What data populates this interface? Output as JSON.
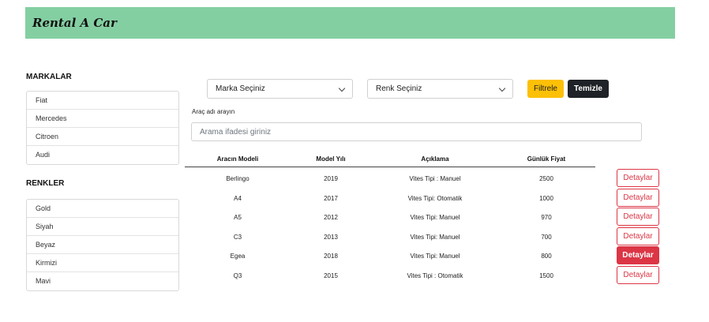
{
  "header": {
    "brand": "Rental A Car"
  },
  "sidebar": {
    "brands_title": "MARKALAR",
    "brands": [
      "Fiat",
      "Mercedes",
      "Citroen",
      "Audi"
    ],
    "colors_title": "RENKLER",
    "colors": [
      "Gold",
      "Siyah",
      "Beyaz",
      "Kirmizi",
      "Mavi"
    ]
  },
  "filters": {
    "brand_select": "Marka Seçiniz",
    "color_select": "Renk Seçiniz",
    "filter_button": "Filtrele",
    "clear_button": "Temizle"
  },
  "search": {
    "label": "Araç adı arayın",
    "placeholder": "Arama ifadesi giriniz",
    "value": ""
  },
  "table": {
    "headers": [
      "Aracın Modeli",
      "Model Yılı",
      "Açıklama",
      "Günlük Fiyat"
    ],
    "rows": [
      {
        "model": "Berlingo",
        "year": "2019",
        "description": "Vites Tipi : Manuel",
        "price": "2500",
        "button": "Detaylar"
      },
      {
        "model": "A4",
        "year": "2017",
        "description": "Vites Tipi: Otomatik",
        "price": "1000",
        "button": "Detaylar"
      },
      {
        "model": "A5",
        "year": "2012",
        "description": "Vites Tipi: Manuel",
        "price": "970",
        "button": "Detaylar"
      },
      {
        "model": "C3",
        "year": "2013",
        "description": "Vites Tipi: Manuel",
        "price": "700",
        "button": "Detaylar"
      },
      {
        "model": "Egea",
        "year": "2018",
        "description": "Vites Tipi: Manuel",
        "price": "800",
        "button": "Detaylar"
      },
      {
        "model": "Q3",
        "year": "2015",
        "description": "Vites Tipi : Otomatik",
        "price": "1500",
        "button": "Detaylar"
      }
    ],
    "active_row": 4
  },
  "colors": {
    "navbar": "#84cfa2",
    "filter": "#fcc007",
    "clear": "#1f2226",
    "detail": "#dc3545"
  }
}
